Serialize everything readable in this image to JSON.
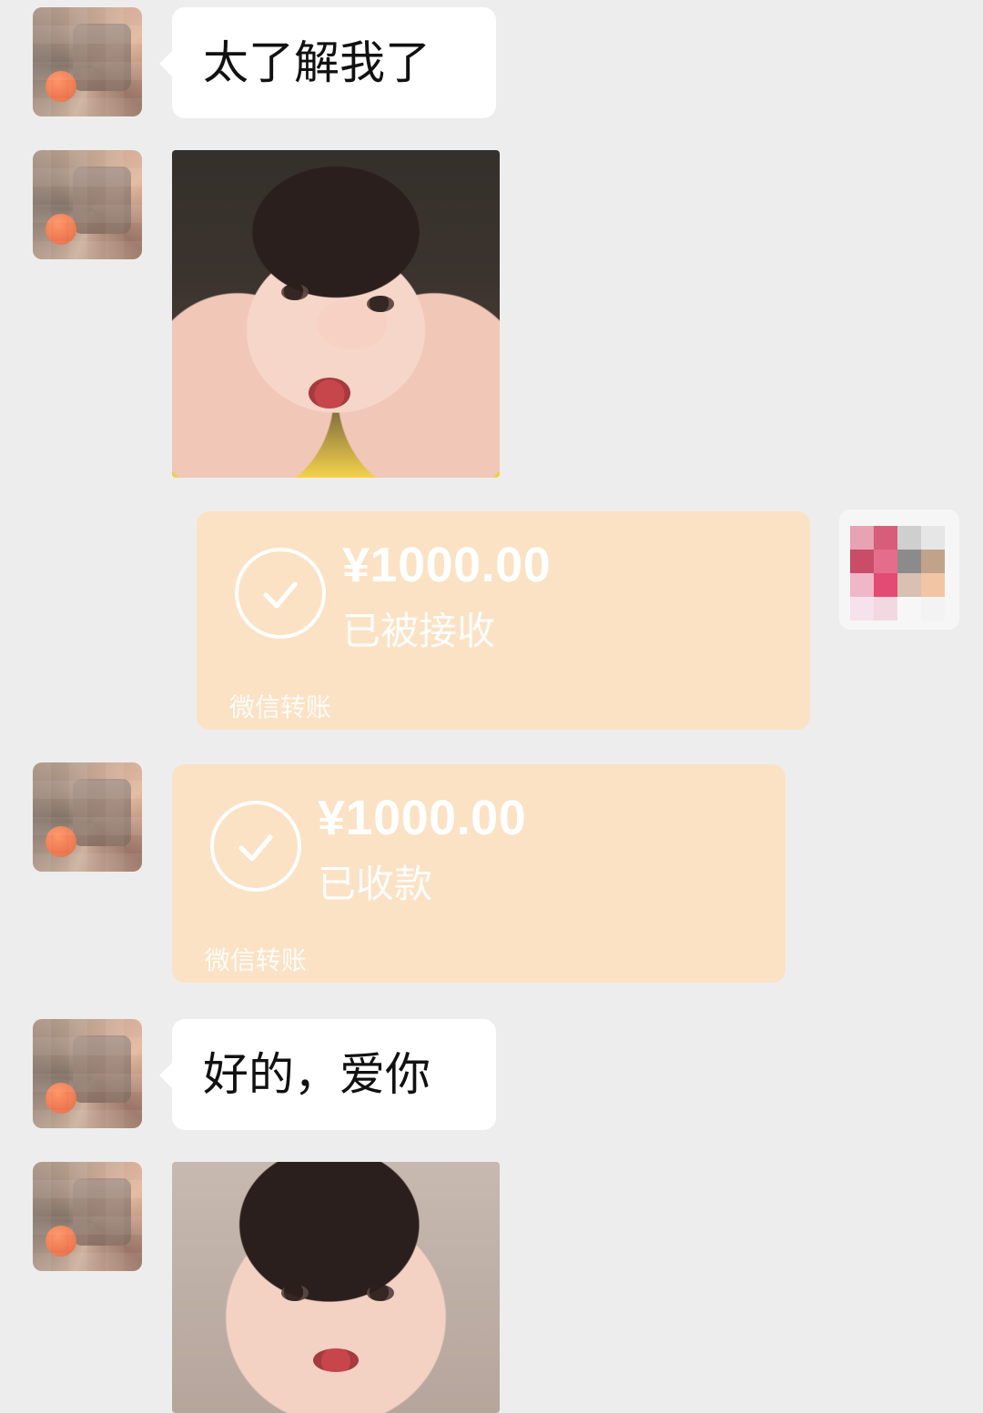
{
  "messages": [
    {
      "type": "text",
      "side": "left",
      "text": "太了解我了"
    },
    {
      "type": "image",
      "side": "left",
      "image": "baby-face-squeezed"
    },
    {
      "type": "transfer",
      "side": "right",
      "amount": "¥1000.00",
      "status": "已被接收",
      "service": "微信转账"
    },
    {
      "type": "transfer",
      "side": "left",
      "amount": "¥1000.00",
      "status": "已收款",
      "service": "微信转账"
    },
    {
      "type": "text",
      "side": "left",
      "text": "好的，爱你"
    },
    {
      "type": "image",
      "side": "left",
      "image": "baby-smiling"
    }
  ],
  "colors": {
    "background": "#ededed",
    "bubble": "#ffffff",
    "transfer_bg": "#fbe2c4",
    "transfer_text": "#ffffff",
    "text": "#111111"
  },
  "icons": {
    "transfer_status": "check-circle-icon"
  }
}
